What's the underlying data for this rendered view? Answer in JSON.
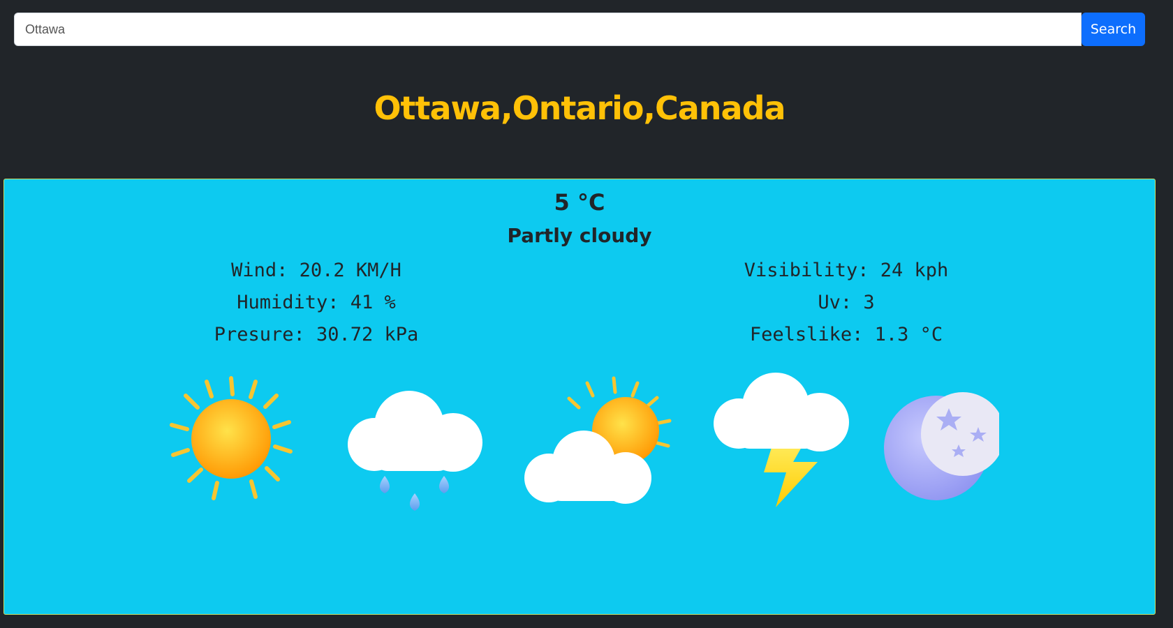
{
  "search": {
    "value": "Ottawa",
    "placeholder": "Ottawa",
    "button_label": "Search"
  },
  "location": {
    "title": "Ottawa,Ontario,Canada"
  },
  "weather": {
    "temperature": "5 °C",
    "condition": "Partly cloudy",
    "left": [
      "Wind: 20.2 KM/H",
      "Humidity: 41 %",
      "Presure: 30.72 kPa"
    ],
    "right": [
      "Visibility: 24 kph",
      "Uv: 3",
      "Feelslike: 1.3 °C"
    ]
  },
  "icons": [
    "sun-icon",
    "rain-cloud-icon",
    "partly-cloudy-icon",
    "thunderstorm-icon",
    "moon-icon"
  ],
  "colors": {
    "background": "#212529",
    "accent": "#ffc107",
    "card": "#0dcaf0",
    "button": "#0d6efd"
  }
}
